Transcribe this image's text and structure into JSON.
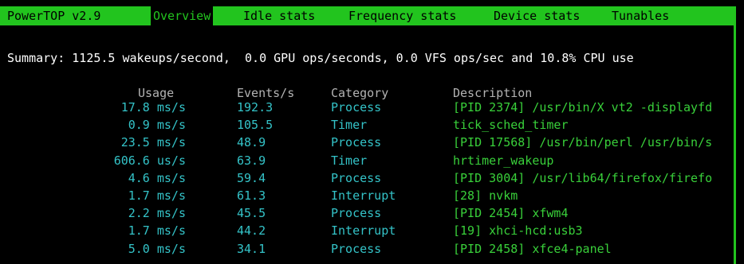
{
  "app": {
    "title": "PowerTOP v2.9"
  },
  "tabs": [
    "Overview",
    "Idle stats",
    "Frequency stats",
    "Device stats",
    "Tunables"
  ],
  "active_tab": "Overview",
  "summary": "Summary: 1125.5 wakeups/second,  0.0 GPU ops/seconds, 0.0 VFS ops/sec and 10.8% CPU use",
  "table": {
    "columns": [
      "Usage",
      "Events/s",
      "Category",
      "Description"
    ],
    "rows": [
      {
        "usage": "17.8 ms/s",
        "events": "192.3",
        "category": "Process",
        "description": "[PID 2374] /usr/bin/X vt2 -displayfd"
      },
      {
        "usage": "0.9 ms/s",
        "events": "105.5",
        "category": "Timer",
        "description": "tick_sched_timer"
      },
      {
        "usage": "23.5 ms/s",
        "events": "48.9",
        "category": "Process",
        "description": "[PID 17568] /usr/bin/perl /usr/bin/s"
      },
      {
        "usage": "606.6 us/s",
        "events": "63.9",
        "category": "Timer",
        "description": "hrtimer_wakeup"
      },
      {
        "usage": "4.6 ms/s",
        "events": "59.4",
        "category": "Process",
        "description": "[PID 3004] /usr/lib64/firefox/firefo"
      },
      {
        "usage": "1.7 ms/s",
        "events": "61.3",
        "category": "Interrupt",
        "description": "[28] nvkm"
      },
      {
        "usage": "2.2 ms/s",
        "events": "45.5",
        "category": "Process",
        "description": "[PID 2454] xfwm4"
      },
      {
        "usage": "1.7 ms/s",
        "events": "44.2",
        "category": "Interrupt",
        "description": "[19] xhci-hcd:usb3"
      },
      {
        "usage": "5.0 ms/s",
        "events": "34.1",
        "category": "Process",
        "description": "[PID 2458] xfce4-panel"
      }
    ]
  },
  "colors": {
    "accent": "#22c41e",
    "header": "#b3b3b3",
    "data": "#34c3c8",
    "description": "#39d03a",
    "background": "#000000"
  }
}
